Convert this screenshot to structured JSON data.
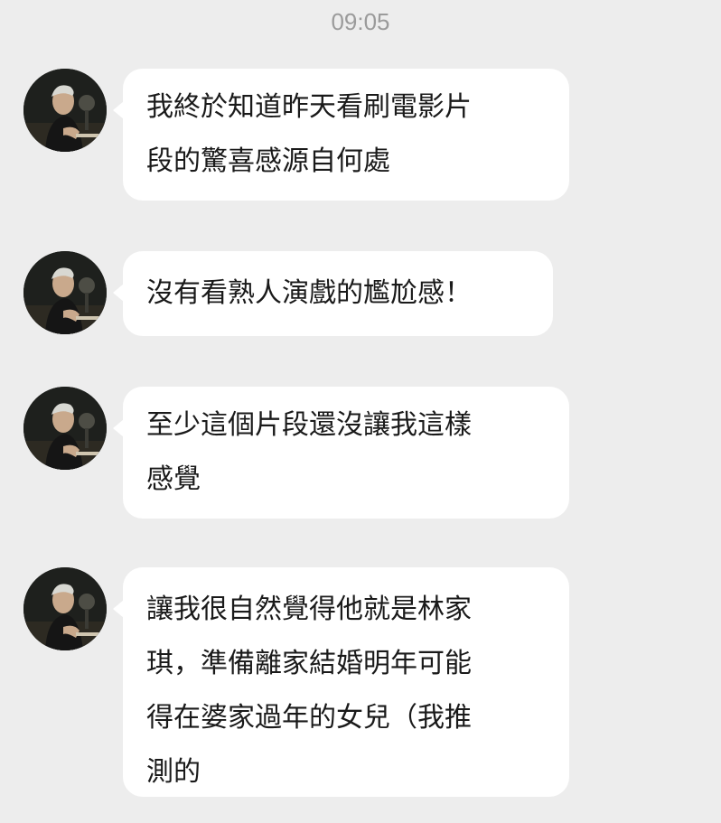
{
  "chat": {
    "timestamp": "09:05",
    "messages": [
      {
        "text": "我終於知道昨天看刷電影片\n段的驚喜感源自何處",
        "avatar_icon": "contact-avatar"
      },
      {
        "text": "沒有看熟人演戲的尷尬感！",
        "avatar_icon": "contact-avatar"
      },
      {
        "text": "至少這個片段還沒讓我這樣\n感覺",
        "avatar_icon": "contact-avatar"
      },
      {
        "text": "讓我很自然覺得他就是林家\n琪，準備離家結婚明年可能\n得在婆家過年的女兒（我推\n測的",
        "avatar_icon": "contact-avatar"
      }
    ]
  },
  "colors": {
    "background": "#ededed",
    "bubble": "#ffffff",
    "text": "#1a1a1a",
    "timestamp": "#9b9b9b"
  }
}
